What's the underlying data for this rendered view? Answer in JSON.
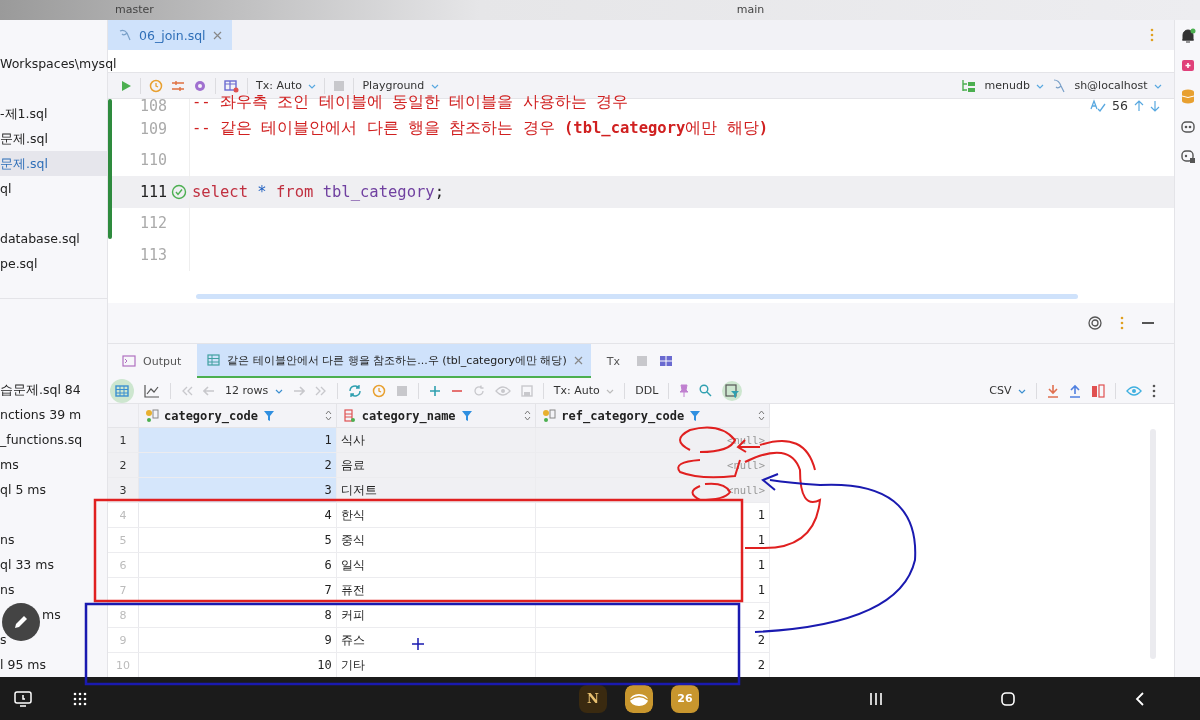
{
  "title_bar": {
    "branch": "master",
    "vcs_branch": "main"
  },
  "project_tree": {
    "items": [
      {
        "label": "Workspaces\\mysql",
        "selected": false
      },
      {
        "label": "-제1.sql",
        "selected": false
      },
      {
        "label": "문제.sql",
        "selected": false
      },
      {
        "label": "문제.sql",
        "selected": true
      },
      {
        "label": "ql",
        "selected": false
      },
      {
        "label": "database.sql",
        "selected": false
      },
      {
        "label": "pe.sql",
        "selected": false
      }
    ]
  },
  "editor": {
    "tab": {
      "label": "06_join.sql",
      "selected": true
    },
    "toolbar": {
      "tx": "Tx: Auto",
      "mode": "Playground",
      "schema": "menudb",
      "connection": "sh@localhost"
    },
    "inspections": "56",
    "lines": [
      {
        "number": "108",
        "current": false,
        "tokens": [
          {
            "kind": "comment",
            "text": "-- 좌우측 조인 테이블에 동일한 테이블을 사용하는 경우"
          }
        ]
      },
      {
        "number": "109",
        "current": false,
        "tokens": [
          {
            "kind": "comment",
            "text": "-- 같은 테이블안에서 다른 행을 참조하는 경우 **(tbl_category**에만 해당**)**"
          }
        ]
      },
      {
        "number": "110",
        "current": false
      },
      {
        "number": "111",
        "current": true,
        "ok": true,
        "tokens": [
          {
            "kind": "keyword",
            "text": "select"
          },
          {
            "kind": "operator",
            "text": " * "
          },
          {
            "kind": "keyword",
            "text": "from"
          },
          {
            "kind": "identifier",
            "text": " tbl_category"
          },
          {
            "kind": "plain",
            "text": ";"
          }
        ]
      },
      {
        "number": "112",
        "current": false
      },
      {
        "number": "113",
        "current": false
      }
    ]
  },
  "services": {
    "items": [
      {
        "label": "습문제.sql  84"
      },
      {
        "label": "nctions  39 m"
      },
      {
        "label": "_functions.sq"
      },
      {
        "label": "ms"
      },
      {
        "label": "ql  5 ms"
      },
      {
        "label": "ns"
      },
      {
        "label": "ql  33 ms"
      },
      {
        "label": "ns"
      },
      {
        "label": "ms"
      },
      {
        "label": "s"
      },
      {
        "label": "l 95 ms"
      }
    ]
  },
  "results": {
    "tabs": [
      {
        "kind": "output",
        "label": "Output",
        "selected": false
      },
      {
        "kind": "grid",
        "label": "같은 테이블안에서 다른 행을 참조하는...우 (tbl_category에만 해당)",
        "selected": true
      },
      {
        "kind": "text",
        "label": "Tx",
        "selected": false
      }
    ],
    "toolbar": {
      "rows": "12 rows",
      "tx": "Tx: Auto",
      "ddl": "DDL",
      "format": "CSV"
    },
    "table": {
      "columns": [
        {
          "kind": "key",
          "label": "category_code"
        },
        {
          "kind": "column",
          "label": "category_name"
        },
        {
          "kind": "key",
          "label": "ref_category_code"
        }
      ],
      "rows": [
        {
          "number": "1",
          "category_code": "1",
          "category_name": "식사",
          "ref_category_code": "<null>",
          "ref_null": true,
          "selected": true
        },
        {
          "number": "2",
          "category_code": "2",
          "category_name": "음료",
          "ref_category_code": "<null>",
          "ref_null": true,
          "selected": true
        },
        {
          "number": "3",
          "category_code": "3",
          "category_name": "디저트",
          "ref_category_code": "<null>",
          "ref_null": true,
          "selected": true
        },
        {
          "number": "4",
          "category_code": "4",
          "category_name": "한식",
          "ref_category_code": "1",
          "ref_null": false,
          "selected": false
        },
        {
          "number": "5",
          "category_code": "5",
          "category_name": "중식",
          "ref_category_code": "1",
          "ref_null": false,
          "selected": false
        },
        {
          "number": "6",
          "category_code": "6",
          "category_name": "일식",
          "ref_category_code": "1",
          "ref_null": false,
          "selected": false
        },
        {
          "number": "7",
          "category_code": "7",
          "category_name": "퓨전",
          "ref_category_code": "1",
          "ref_null": false,
          "selected": false
        },
        {
          "number": "8",
          "category_code": "8",
          "category_name": "커피",
          "ref_category_code": "2",
          "ref_null": false,
          "selected": false
        },
        {
          "number": "9",
          "category_code": "9",
          "category_name": "쥬스",
          "ref_category_code": "2",
          "ref_null": false,
          "selected": false
        },
        {
          "number": "10",
          "category_code": "10",
          "category_name": "기타",
          "ref_category_code": "2",
          "ref_null": false,
          "selected": false
        }
      ]
    }
  },
  "nav_bar": {
    "notes_letter": "N",
    "calendar_day": "26"
  }
}
